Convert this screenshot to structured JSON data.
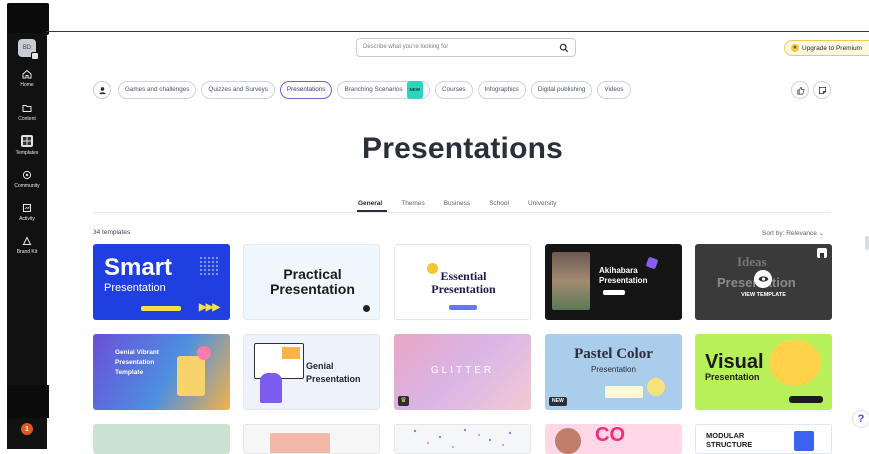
{
  "sidebar": {
    "avatar_initials": "BD",
    "items": [
      {
        "label": "Home",
        "icon": "home-icon"
      },
      {
        "label": "Content",
        "icon": "folder-icon"
      },
      {
        "label": "Templates",
        "icon": "templates-icon"
      },
      {
        "label": "Community",
        "icon": "community-icon"
      },
      {
        "label": "Activity",
        "icon": "activity-icon"
      },
      {
        "label": "Brand Kit",
        "icon": "brand-kit-icon"
      }
    ],
    "notification_count": "1"
  },
  "search": {
    "placeholder": "Describe what you're looking for"
  },
  "upgrade_label": "Upgrade to Premium",
  "filters": [
    {
      "label": "Games and challenges",
      "active": false
    },
    {
      "label": "Quizzes and Surveys",
      "active": false
    },
    {
      "label": "Presentations",
      "active": true
    },
    {
      "label": "Branching Scenarios",
      "active": false,
      "badge": "NEW"
    },
    {
      "label": "Courses",
      "active": false
    },
    {
      "label": "Infographics",
      "active": false
    },
    {
      "label": "Digital publishing",
      "active": false
    },
    {
      "label": "Videos",
      "active": false
    }
  ],
  "page_title": "Presentations",
  "tabs": [
    "General",
    "Themes",
    "Business",
    "School",
    "University"
  ],
  "template_count": "34 templates",
  "sort_label": "Sort by: Relevance",
  "cards": [
    {
      "title_a": "Smart",
      "title_b": "Presentation"
    },
    {
      "title_a": "Practical",
      "title_b": "Presentation"
    },
    {
      "title_a": "Essential",
      "title_b": "Presentation"
    },
    {
      "title_a": "Akihabara",
      "title_b": "Presentation"
    },
    {
      "title_a": "Ideas",
      "title_b": "Presentation",
      "overlay": "VIEW TEMPLATE"
    },
    {
      "title_a": "Genial Vibrant",
      "title_b": "Presentation",
      "title_c": "Template"
    },
    {
      "title_a": "Genial",
      "title_b": "Presentation"
    },
    {
      "title_a": "GLITTER"
    },
    {
      "title_a": "Pastel Color",
      "title_b": "Presentation",
      "badge": "NEW"
    },
    {
      "title_a": "Visual",
      "title_b": "Presentation"
    },
    {
      "title_a": ""
    },
    {
      "title_a": ""
    },
    {
      "title_a": ""
    },
    {
      "title_a": "CO"
    },
    {
      "title_a": "MODULAR",
      "title_b": "STRUCTURE"
    }
  ],
  "colors": {
    "accent": "#7b5bd6",
    "sidebar": "#111111",
    "premium": "#f2c94c"
  }
}
